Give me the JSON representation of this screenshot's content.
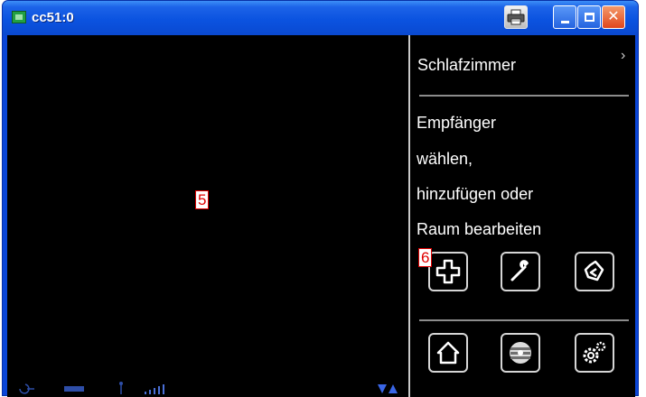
{
  "window": {
    "title": "cc51:0",
    "buttons": {
      "print": "printer-icon",
      "minimize": "minimize-icon",
      "maximize": "maximize-icon",
      "close": "close-icon",
      "close_glyph": "✕"
    }
  },
  "markers": {
    "left_pane": "5",
    "add_button": "6"
  },
  "panel": {
    "room_title": "Schlafzimmer",
    "scroll_glyph": "›",
    "prompt_lines": [
      "Empfänger",
      "wählen,",
      "hinzufügen oder",
      "Raum bearbeiten"
    ]
  },
  "actions_top": [
    "plus-icon",
    "wrench-icon",
    "back-arrow-icon"
  ],
  "actions_bottom": [
    "home-icon",
    "fan-icon",
    "settings-gears-icon"
  ],
  "colors": {
    "titlebar": "#0a53e0",
    "client_bg": "#000000",
    "panel_text": "#ffffff",
    "button_border": "#d6d6d6",
    "marker_red": "#e00000"
  }
}
